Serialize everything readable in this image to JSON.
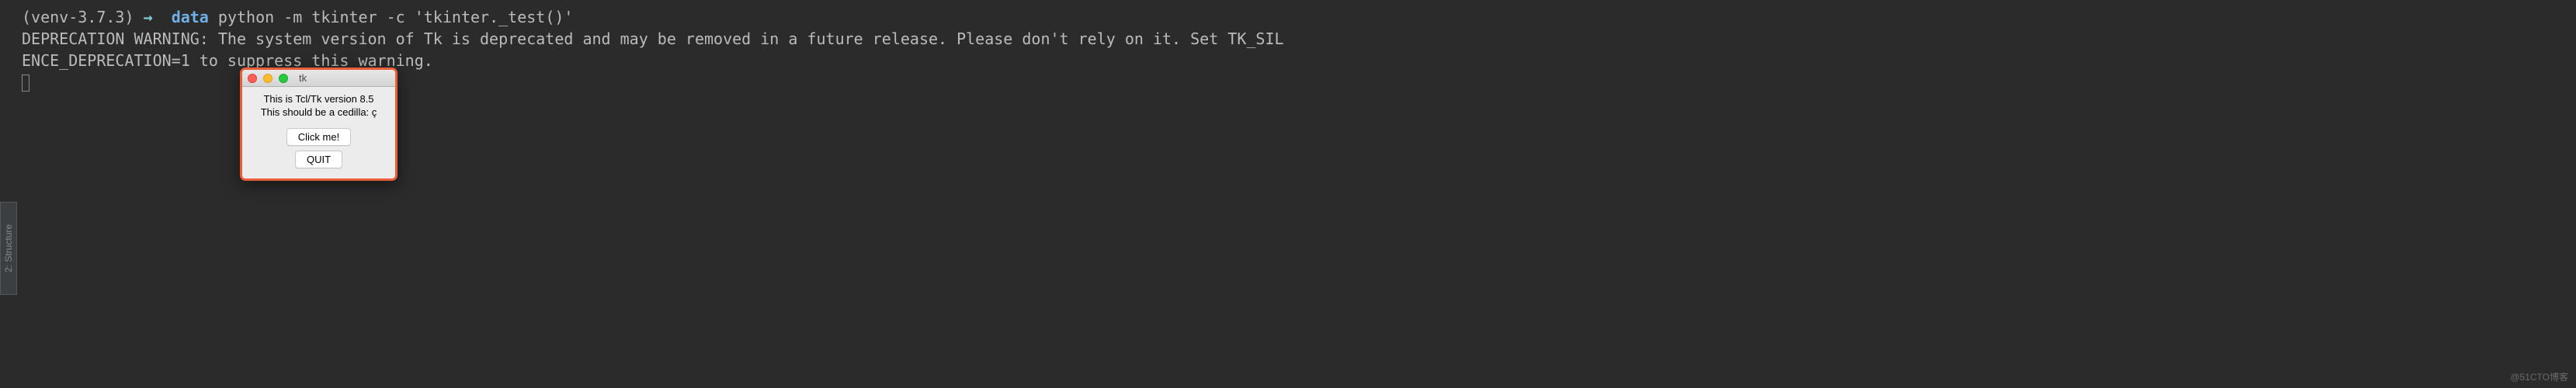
{
  "sidebar": {
    "tab_label": "2: Structure"
  },
  "terminal": {
    "venv": "(venv-3.7.3)",
    "arrow": "→",
    "dir": "data",
    "command": "python -m tkinter -c 'tkinter._test()'",
    "output_line1": "DEPRECATION WARNING: The system version of Tk is deprecated and may be removed in a future release. Please don't rely on it. Set TK_SIL",
    "output_line2": "ENCE_DEPRECATION=1 to suppress this warning."
  },
  "tk_window": {
    "title": "tk",
    "label_line1": "This is Tcl/Tk version 8.5",
    "label_line2": "This should be a cedilla: ç",
    "click_button": "Click me!",
    "quit_button": "QUIT"
  },
  "watermark": "@51CTO博客"
}
